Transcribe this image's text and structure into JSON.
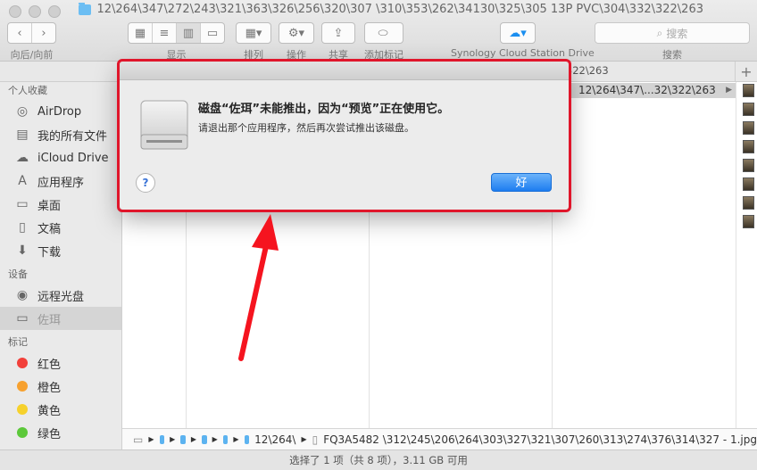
{
  "window": {
    "title": "12\\264\\347\\272\\243\\321\\363\\326\\256\\320\\307 \\310\\353\\262\\34130\\325\\305 13P PVC\\304\\332\\322\\263"
  },
  "toolbar": {
    "nav_label": "向后/向前",
    "view_label": "显示",
    "sort_label": "排列",
    "action_label": "操作",
    "share_label": "共享",
    "tag_label": "添加标记",
    "cloud_label": "Synology Cloud Station Drive",
    "search_placeholder": "搜索",
    "search_label": "搜索"
  },
  "tab_path": "\\322\\263",
  "sidebar": {
    "favorites_header": "个人收藏",
    "favorites": [
      "AirDrop",
      "我的所有文件",
      "iCloud Drive",
      "应用程序",
      "桌面",
      "文稿",
      "下载"
    ],
    "devices_header": "设备",
    "devices": [
      "远程光盘",
      "佐珥"
    ],
    "tags_header": "标记",
    "tags": [
      {
        "label": "红色",
        "color": "#f2403a"
      },
      {
        "label": "橙色",
        "color": "#f7a12f"
      },
      {
        "label": "黄色",
        "color": "#f6d12c"
      },
      {
        "label": "绿色",
        "color": "#5cc83a"
      }
    ]
  },
  "column_selected": "12\\264\\347\\...32\\322\\263",
  "breadcrumb": {
    "folder_item": "12\\264\\",
    "file_item": "FQ3A5482 \\312\\245\\206\\264\\303\\327\\321\\307\\260\\313\\274\\376\\314\\327 - 1.jpg"
  },
  "status": "选择了 1 项（共 8 项），3.11 GB 可用",
  "dialog": {
    "title": "磁盘“佐珥”未能推出，因为“预览”正在使用它。",
    "message": "请退出那个应用程序，然后再次尝试推出该磁盘。",
    "help_label": "?",
    "ok_label": "好",
    "accent_color": "#1d7df0",
    "highlight_color": "#e0162b"
  }
}
